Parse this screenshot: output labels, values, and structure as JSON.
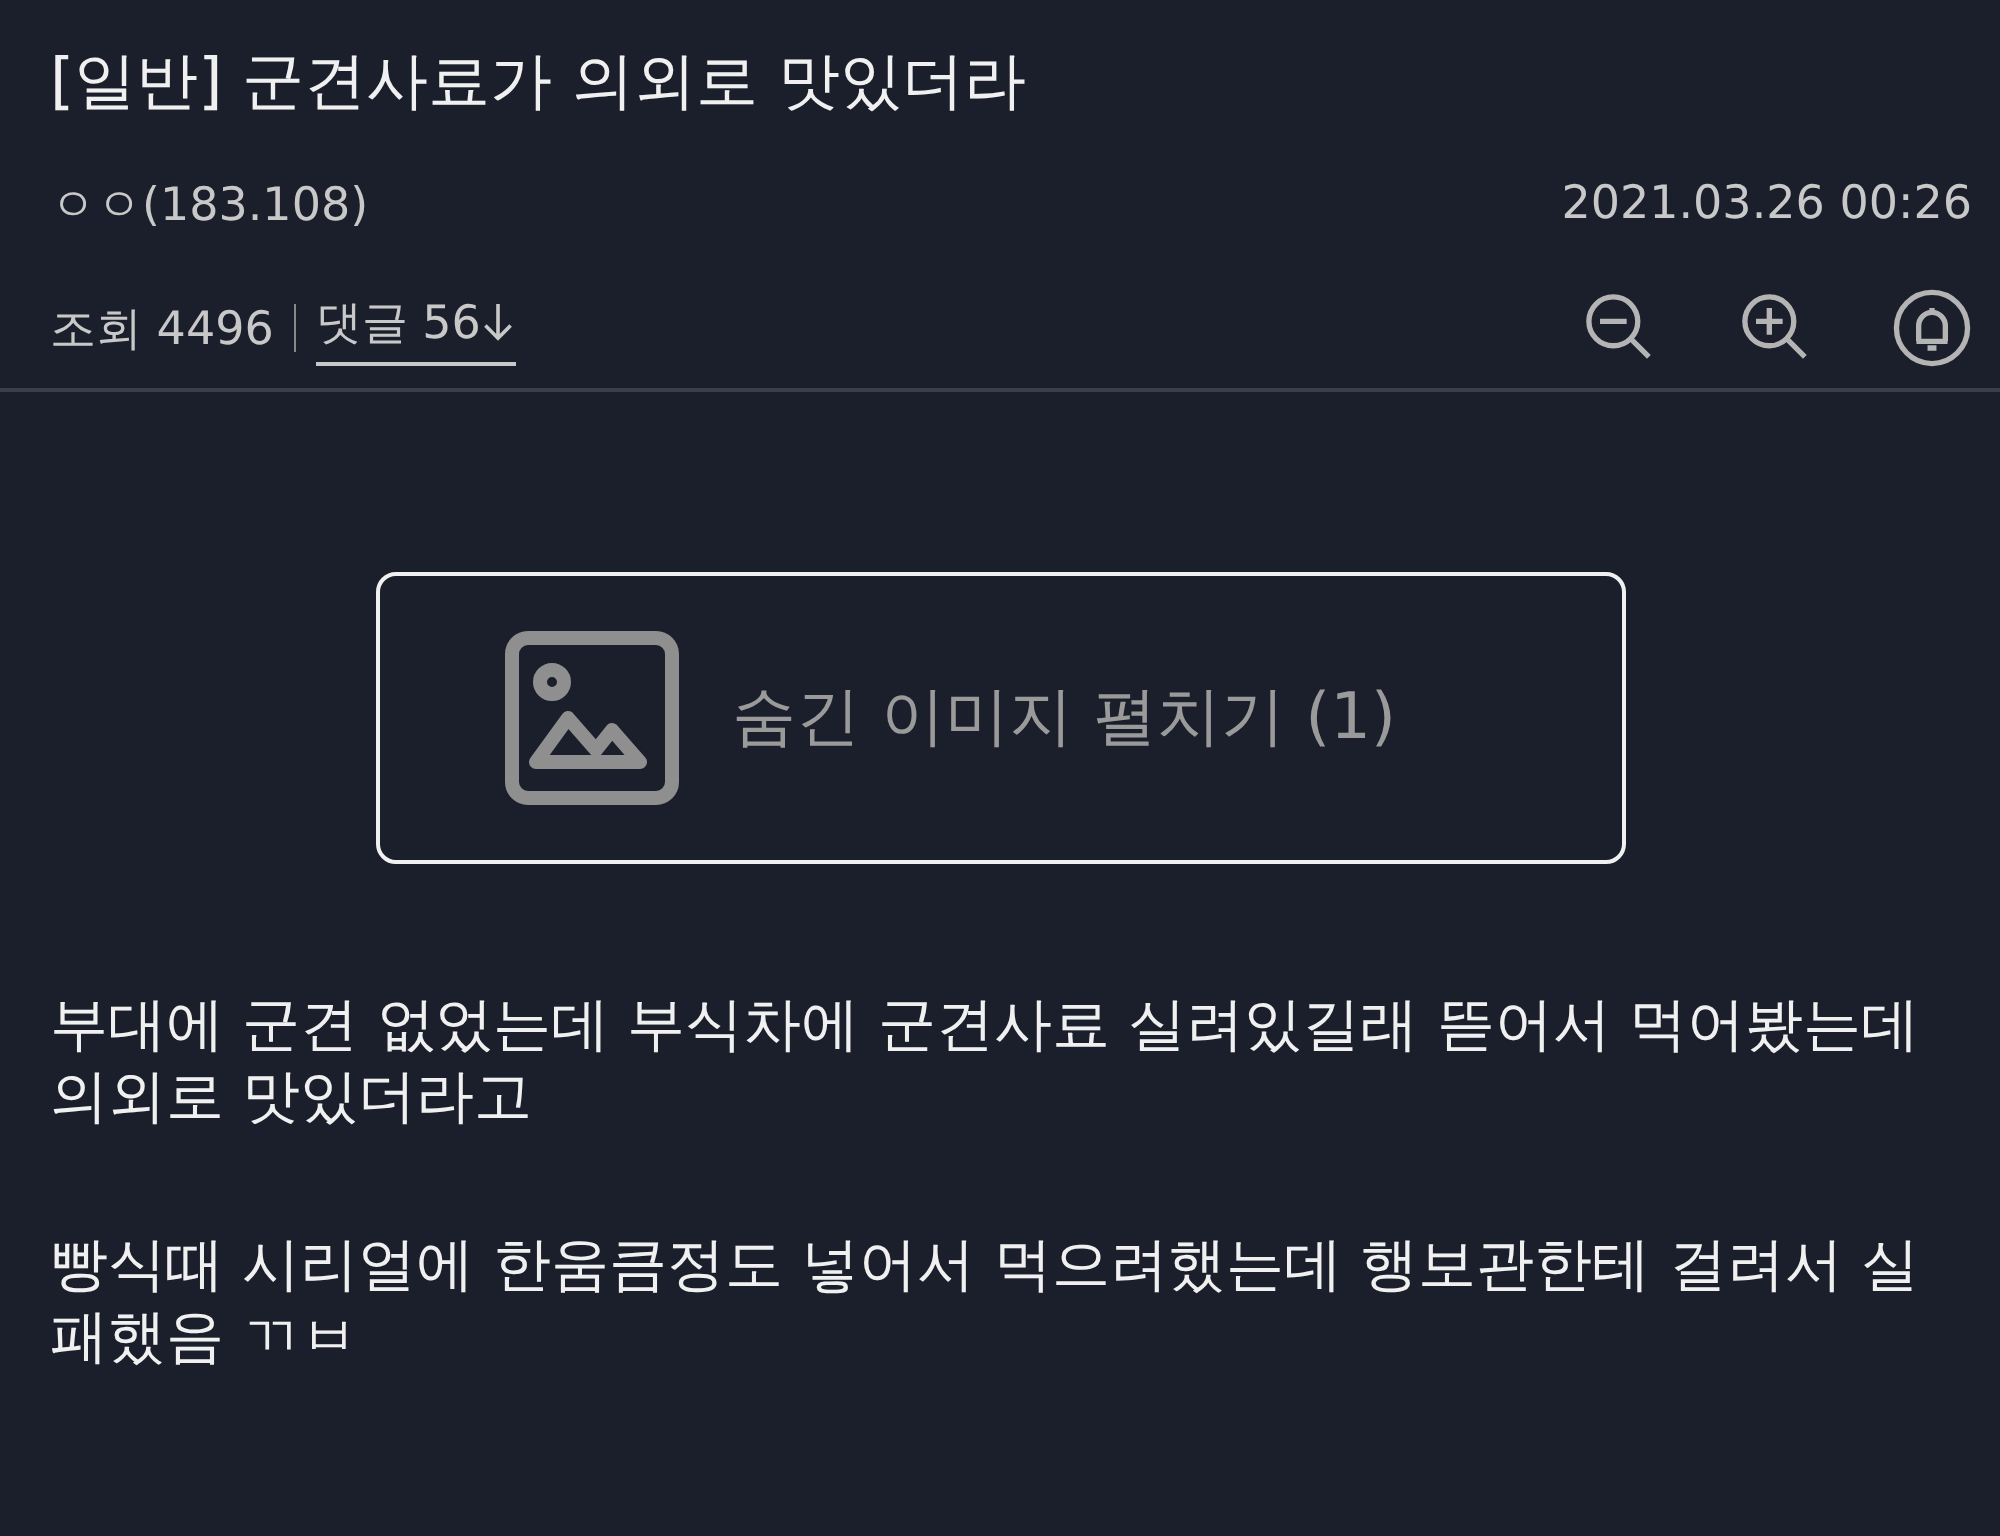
{
  "post": {
    "title": "[일반] 군견사료가 의외로 맛있더라",
    "author": "ㅇㅇ(183.108)",
    "date": "2021.03.26 00:26",
    "views": "조회 4496",
    "comments": "댓글 56"
  },
  "toolbar": [
    {
      "kind": "zoom-out"
    },
    {
      "kind": "zoom-in"
    },
    {
      "kind": "bell"
    }
  ],
  "hidden_image_button": {
    "label": "숨긴 이미지 펼치기 (1)"
  },
  "paragraphs": [
    "부대에 군견 없었는데 부식차에 군견사료 실려있길래 뜯어서 먹어봤는데 의외로 맛있더라고",
    "빵식때 시리얼에 한움큼정도 넣어서 먹으려했는데 행보관한테 걸려서 실패했음 ㄲㅂ"
  ]
}
